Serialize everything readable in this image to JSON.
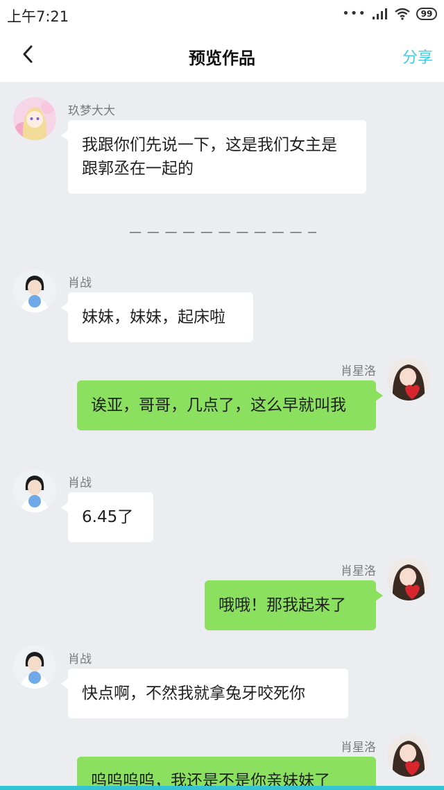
{
  "status_bar": {
    "time": "上午7:21",
    "battery": "99"
  },
  "nav": {
    "title": "预览作品",
    "share_label": "分享"
  },
  "divider": "— — — — — — — — — — — — — — — — —",
  "messages": [
    {
      "side": "left",
      "sender": "玖梦大大",
      "text": "我跟你们先说一下，这是我们女主是跟郭丞在一起的",
      "avatar": "anime-girl-avatar"
    },
    {
      "side": "left",
      "sender": "肖战",
      "text": "妹妹，妹妹，起床啦",
      "avatar": "xiao-zhan-avatar"
    },
    {
      "side": "right",
      "sender": "肖星洛",
      "text": "诶亚，哥哥，几点了，这么早就叫我",
      "avatar": "xiao-xingluo-avatar"
    },
    {
      "side": "left",
      "sender": "肖战",
      "text": "6.45了",
      "avatar": "xiao-zhan-avatar"
    },
    {
      "side": "right",
      "sender": "肖星洛",
      "text": "哦哦！那我起来了",
      "avatar": "xiao-xingluo-avatar"
    },
    {
      "side": "left",
      "sender": "肖战",
      "text": "快点啊，不然我就拿兔牙咬死你",
      "avatar": "xiao-zhan-avatar"
    },
    {
      "side": "right",
      "sender": "肖星洛",
      "text": "呜呜呜呜，我还是不是你亲妹妹了",
      "avatar": "xiao-xingluo-avatar"
    }
  ],
  "colors": {
    "accent": "#46c9e6",
    "self_bubble": "#8ce060",
    "other_bubble": "#ffffff",
    "background": "#ebedf0"
  }
}
